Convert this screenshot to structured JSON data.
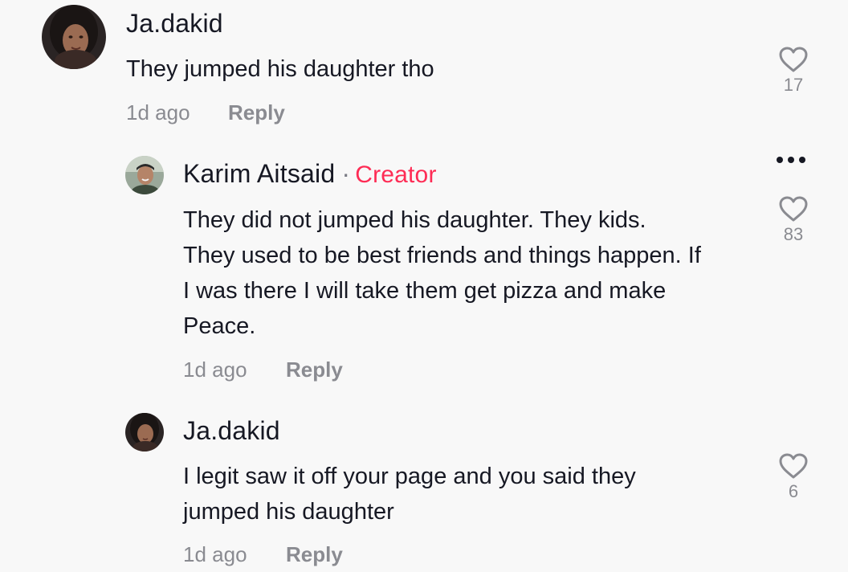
{
  "comments": [
    {
      "username": "Ja.dakid",
      "text": "They jumped his daughter tho",
      "time": "1d ago",
      "reply_label": "Reply",
      "likes": "17",
      "avatar_icon": "user-avatar-photo"
    },
    {
      "username": "Karim Aitsaid",
      "separator": "·",
      "badge": "Creator",
      "text": "They did not jumped his daughter. They kids.\nThey used to be best friends and things happen. If\nI was there I will take them get pizza and make\nPeace.",
      "time": "1d ago",
      "reply_label": "Reply",
      "likes": "83",
      "avatar_icon": "user-avatar-photo"
    },
    {
      "username": "Ja.dakid",
      "text": "I legit saw it off your page and you said they\njumped his daughter",
      "time": "1d ago",
      "reply_label": "Reply",
      "likes": "6",
      "avatar_icon": "user-avatar-photo"
    }
  ],
  "icons": {
    "like": "heart-outline-icon",
    "more": "more-options-icon"
  },
  "colors": {
    "creator_badge": "#fe2c55",
    "secondary_text": "#8a8b91",
    "primary_text": "#161823",
    "background": "#f8f8f8"
  }
}
